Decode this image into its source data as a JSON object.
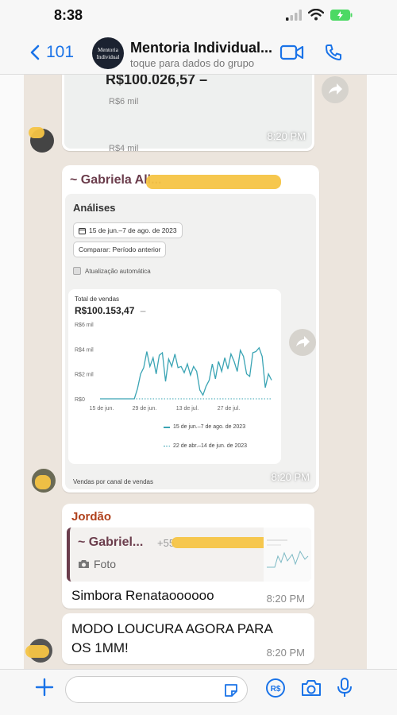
{
  "status": {
    "time": "8:38"
  },
  "header": {
    "back_count": "101",
    "title": "Mentoria Individual...",
    "subtitle": "toque para dados do grupo",
    "avatar_line1": "Mentoria",
    "avatar_line2": "Individual"
  },
  "msg1": {
    "amount": "R$100.026,57 –",
    "axis": "R$6 mil",
    "axis2": "R$4 mil",
    "time": "8:20 PM"
  },
  "msg2": {
    "sender": "~ Gabriela ",
    "sender_suffix": "All...",
    "analytics_title": "Análises",
    "date_range": "15 de jun.–7 de ago. de 2023",
    "compare": "Comparar: Período anterior",
    "auto_update": "Atualização automática",
    "total_label": "Total de vendas",
    "total_value": "R$100.153,47",
    "total_dash": "–",
    "legend_current": "15 de jun.–7 de ago. de 2023",
    "legend_previous": "22 de abr.–14 de jun. de 2023",
    "bottom_caption": "Vendas por canal de vendas",
    "time": "8:20 PM"
  },
  "chart_data": {
    "type": "line",
    "y_ticks": [
      "R$6 mil",
      "R$4 mil",
      "R$2 mil",
      "R$0"
    ],
    "x_ticks": [
      "15 de jun.",
      "29 de jun.",
      "13 de jul.",
      "27 de jul."
    ],
    "ylim": [
      0,
      6000
    ],
    "series": [
      {
        "name": "15 de jun.–7 de ago. de 2023",
        "values": [
          0,
          0,
          0,
          0,
          0,
          0,
          0,
          0,
          0,
          0,
          0,
          0,
          800,
          2000,
          2500,
          3800,
          2600,
          3300,
          2000,
          3500,
          3700,
          1400,
          3200,
          2600,
          3600,
          2500,
          2600,
          2100,
          2800,
          1900,
          2600,
          2200,
          700,
          300,
          1000,
          1500,
          2800,
          1600,
          3000,
          2200,
          3300,
          2400,
          3600,
          3000,
          2200,
          3900,
          3400,
          2000,
          1800,
          3700,
          3800,
          4100,
          3400,
          900,
          2000,
          1500
        ]
      },
      {
        "name": "22 de abr.–14 de jun. de 2023",
        "values": [
          0,
          0,
          0,
          0,
          0,
          0,
          0,
          0,
          0,
          0,
          0,
          0,
          0,
          0,
          0,
          0,
          0,
          0,
          0,
          0,
          0,
          0,
          0,
          0,
          0,
          0,
          0,
          0,
          0,
          0,
          0,
          0,
          0,
          0,
          0,
          0,
          0,
          0,
          0,
          0,
          0,
          0,
          0,
          0,
          0,
          0,
          0,
          0,
          0,
          0,
          0,
          0,
          0,
          0,
          0,
          0
        ]
      }
    ]
  },
  "msg3": {
    "sender": "Jordão",
    "quoted_sender": "~ Gabriel...",
    "quoted_phone": "+55",
    "quoted_type": "Foto",
    "text": "Simbora Renataoooooo",
    "time": "8:20 PM"
  },
  "msg4": {
    "text_line1": "MODO LOUCURA AGORA PARA",
    "text_line2": "OS 1MM!",
    "time": "8:20 PM"
  },
  "colors": {
    "accent": "#1a73e8",
    "chart_line": "#3aa4b4",
    "highlight": "#f6c445",
    "sender_jordao": "#b0411c",
    "sender_gabriela": "#6b3d4c"
  }
}
